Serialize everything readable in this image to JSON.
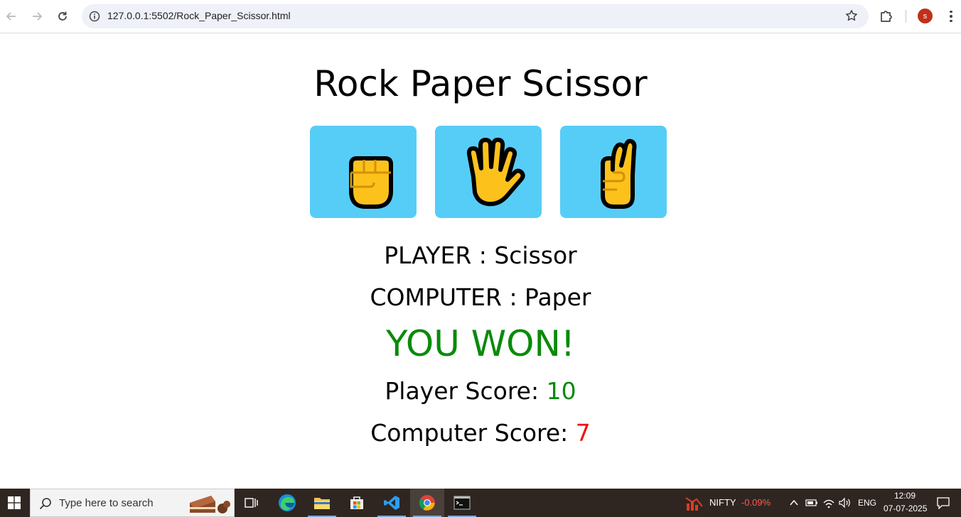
{
  "browser": {
    "url": "127.0.0.1:5502/Rock_Paper_Scissor.html",
    "profile_initial": "s"
  },
  "game": {
    "title": "Rock Paper Scissor",
    "choices": [
      {
        "name": "Rock",
        "icon": "raised-fist-icon"
      },
      {
        "name": "Paper",
        "icon": "raised-hand-icon"
      },
      {
        "name": "Scissor",
        "icon": "victory-hand-icon"
      }
    ],
    "player_label": "PLAYER : Scissor",
    "computer_label": "COMPUTER : Paper",
    "result": "YOU WON!",
    "player_score_label": "Player Score:",
    "player_score": "10",
    "computer_score_label": "Computer Score:",
    "computer_score": "7",
    "colors": {
      "button_bg": "#56cdf7",
      "win": "#0a8a0a",
      "loss": "#ee1111"
    }
  },
  "taskbar": {
    "search_placeholder": "Type here to search",
    "stock_name": "NIFTY",
    "stock_change": "-0.09%",
    "language": "ENG",
    "time": "12:09",
    "date": "07-07-2025"
  }
}
